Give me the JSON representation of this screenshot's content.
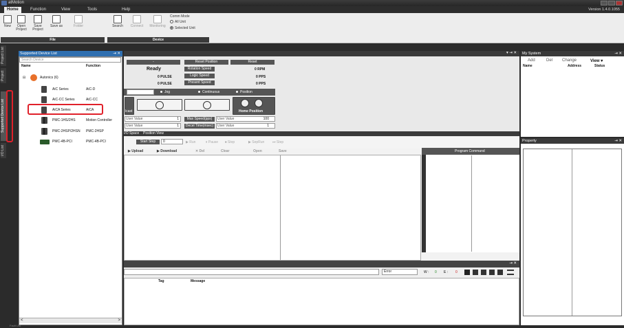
{
  "window": {
    "title": "atMotion",
    "version": "Version 1.4.0.1055"
  },
  "menu": {
    "tabs": [
      "Home",
      "Function",
      "View",
      "Tools",
      "Help"
    ],
    "active": "Home"
  },
  "ribbon": {
    "file_buttons": [
      "New",
      "Open\nProject",
      "Save\nProject",
      "Save as",
      "Folder"
    ],
    "device_buttons": [
      "Search",
      "Connect",
      "Monitoring"
    ],
    "comm_mode_label": "Comm Mode",
    "comm_options": [
      "All Unit",
      "Selected Unit"
    ],
    "comm_selected": "Selected Unit",
    "groups": [
      "File",
      "Device"
    ]
  },
  "side_tabs": [
    "Project List",
    "Project",
    "Supported Device List",
    "I/O List"
  ],
  "device_panel": {
    "title": "Supported Device List",
    "pin_close": "⇥ ✕",
    "search_placeholder": "Search Device",
    "col_name": "Name",
    "col_function": "Function",
    "root": "Autonics (6)",
    "rows": [
      {
        "name": "AiC Series",
        "function": "AiC-D"
      },
      {
        "name": "AiC-CC Series",
        "function": "AiC-CC"
      },
      {
        "name": "AiCA Series",
        "function": "AiCA"
      },
      {
        "name": "PMC-1HS/2HS",
        "function": "Motion Controller"
      },
      {
        "name": "PMC-2HSP/2HSN",
        "function": "PMC-2HSP"
      },
      {
        "name": "PMC-4B-PCI",
        "function": "PMC-4B-PCI"
      }
    ],
    "scroll_left": "<",
    "scroll_right": ">"
  },
  "control": {
    "pin_close": "▾ ⇥ ✕",
    "dash": "-",
    "reset_position": "Reset Position",
    "reset": "Reset",
    "status": "Ready",
    "rotation_speed_label": "Rotation Speed",
    "rotation_speed_value": "0 RPM",
    "pulse1": "0 PULSE",
    "logic_speed_label": "Logic Speed",
    "logic_speed_value": "0 PPS",
    "pulse2": "0 PULSE",
    "present_speed_label": "Present Speed",
    "present_speed_value": "0 PPS",
    "jog": "Jog",
    "continuous": "Continuous",
    "position": "Position",
    "broadcast": "lcast",
    "home_position": "Home Position",
    "user_value": "User Value",
    "max_speed_label": "Max Speed(pps)",
    "max_speed_value": "100",
    "decel_label": "Decel Time(msec)",
    "decel_value": "1",
    "stepper1": "1",
    "stepper2": "1"
  },
  "program": {
    "tabs": [
      "I/O Space",
      "Position View"
    ],
    "start_step": "Start Step",
    "step_value": "0",
    "toolbar1": [
      "▶ Run",
      "⏸ Pause",
      "⏹ Stop",
      "▶ SepRun",
      "⏭ Step"
    ],
    "toolbar2": [
      "▶ Upload",
      "▶ Download",
      "✕ Del",
      "Clear",
      "Open",
      "Save"
    ],
    "program_command": "Program Command"
  },
  "log": {
    "filter_value": "Error",
    "w_label": "W :",
    "w_value": "0",
    "e_label": "E :",
    "e_value": "0",
    "col_tag": "Tag",
    "col_message": "Message",
    "pin_close": "⇥ ✕"
  },
  "my_system": {
    "title": "My System",
    "pin_close": "⇥ ✕",
    "actions": [
      "Add",
      "Del",
      "Change",
      "View ▾"
    ],
    "col_name": "Name",
    "col_address": "Address",
    "col_status": "Status"
  },
  "property": {
    "title": "Property",
    "pin_close": "⇥ ✕"
  },
  "status_bar": {
    "text": "Fault List"
  }
}
